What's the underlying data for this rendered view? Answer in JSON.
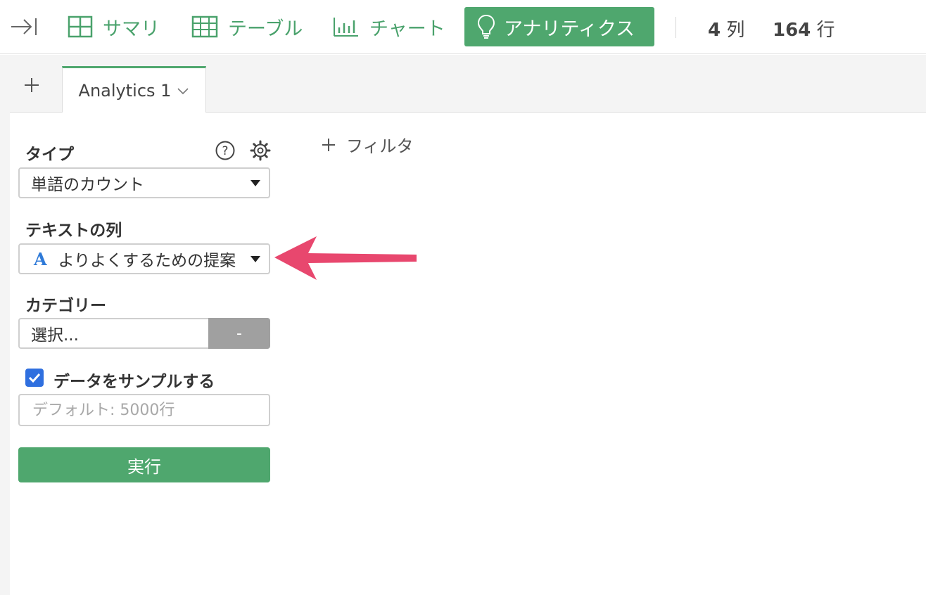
{
  "toolbar": {
    "summary_label": "サマリ",
    "table_label": "テーブル",
    "chart_label": "チャート",
    "analytics_label": "アナリティクス",
    "columns_count": "4",
    "columns_unit": "列",
    "rows_count": "164",
    "rows_unit": "行"
  },
  "tabs": [
    {
      "label": "Analytics 1"
    }
  ],
  "form": {
    "type_label": "タイプ",
    "type_value": "単語のカウント",
    "text_column_label": "テキストの列",
    "text_column_type_glyph": "A",
    "text_column_value": "よりよくするための提案",
    "category_label": "カテゴリー",
    "category_placeholder": "選択...",
    "category_button": "-",
    "sample_label": "データをサンプルする",
    "sample_checked": true,
    "sample_placeholder": "デフォルト: 5000行",
    "run_label": "実行"
  },
  "filter": {
    "label": "フィルタ"
  },
  "colors": {
    "accent": "#4fa76e",
    "arrow": "#e8476e",
    "checkbox": "#2f6fdf"
  }
}
